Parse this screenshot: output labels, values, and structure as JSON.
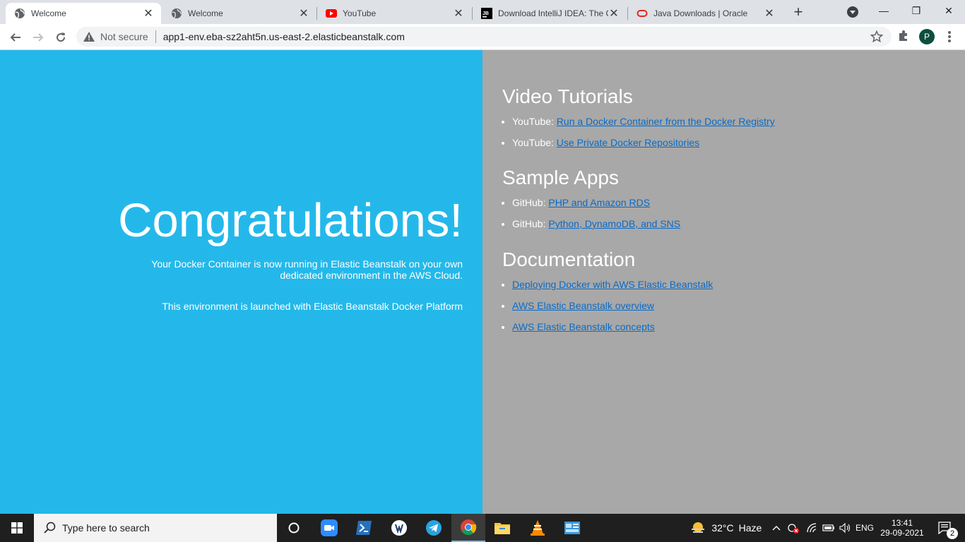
{
  "browser": {
    "tabs": [
      {
        "title": "Welcome",
        "favicon": "globe-icon"
      },
      {
        "title": "Welcome",
        "favicon": "globe-icon"
      },
      {
        "title": "YouTube",
        "favicon": "youtube-icon"
      },
      {
        "title": "Download IntelliJ IDEA: The C",
        "favicon": "jetbrains-icon"
      },
      {
        "title": "Java Downloads | Oracle",
        "favicon": "oracle-icon"
      }
    ],
    "security_label": "Not secure",
    "url": "app1-env.eba-sz2aht5n.us-east-2.elasticbeanstalk.com",
    "profile_initial": "P",
    "window_buttons": {
      "minimize": "—",
      "restore": "❐",
      "close": "✕"
    }
  },
  "page": {
    "heading": "Congratulations!",
    "message_1": "Your Docker Container is now running in Elastic Beanstalk on your own dedicated environment in the AWS Cloud.",
    "message_2": "This environment is launched with Elastic Beanstalk Docker Platform",
    "sections": [
      {
        "title": "Video Tutorials",
        "items": [
          {
            "prefix": "YouTube: ",
            "link": "Run a Docker Container from the Docker Registry"
          },
          {
            "prefix": "YouTube: ",
            "link": "Use Private Docker Repositories"
          }
        ]
      },
      {
        "title": "Sample Apps",
        "items": [
          {
            "prefix": "GitHub: ",
            "link": "PHP and Amazon RDS"
          },
          {
            "prefix": "GitHub: ",
            "link": "Python, DynamoDB, and SNS"
          }
        ]
      },
      {
        "title": "Documentation",
        "items": [
          {
            "prefix": "",
            "link": "Deploying Docker with AWS Elastic Beanstalk"
          },
          {
            "prefix": "",
            "link": "AWS Elastic Beanstalk overview"
          },
          {
            "prefix": "",
            "link": "AWS Elastic Beanstalk concepts"
          }
        ]
      }
    ],
    "colors": {
      "left_bg": "#24b8ea",
      "right_bg": "#a8a8a8",
      "link": "#0b6bc6"
    }
  },
  "taskbar": {
    "search_placeholder": "Type here to search",
    "pinned_apps": [
      "cortana-icon",
      "zoom-icon",
      "powershell-icon",
      "app-icon",
      "telegram-icon",
      "chrome-icon",
      "file-explorer-icon",
      "vlc-icon",
      "control-panel-icon"
    ],
    "weather_temp": "32°C",
    "weather_desc": "Haze",
    "language": "ENG",
    "time": "13:41",
    "date": "29-09-2021",
    "notification_count": "2"
  }
}
